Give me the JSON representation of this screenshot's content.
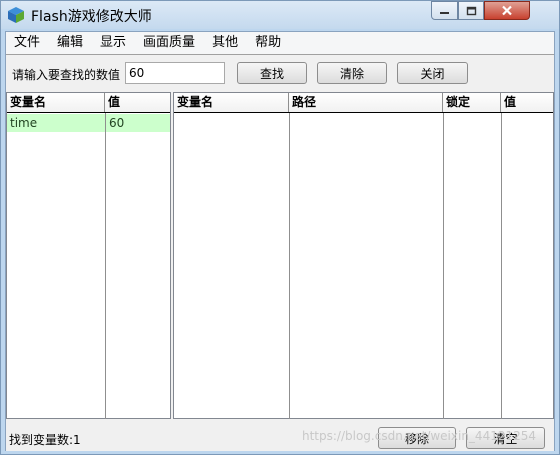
{
  "window": {
    "title": "Flash游戏修改大师"
  },
  "menu": [
    "文件",
    "编辑",
    "显示",
    "画面质量",
    "其他",
    "帮助"
  ],
  "search": {
    "label": "请输入要查找的数值",
    "value": "60",
    "find_label": "查找",
    "clear_label": "清除",
    "close_label": "关闭"
  },
  "left_table": {
    "headers": [
      "变量名",
      "值"
    ],
    "rows": [
      {
        "name": "time",
        "value": "60"
      }
    ]
  },
  "right_table": {
    "headers": [
      "变量名",
      "路径",
      "锁定",
      "值"
    ]
  },
  "status": {
    "found_text": "找到变量数:1",
    "remove_label": "移除",
    "clear_all_label": "清空"
  },
  "watermark": "https://blog.csdn.net/weixin_44121254",
  "colors": {
    "selected_row": "#ccffcc",
    "titlebar": "#c4d9ee",
    "close_button": "#c8412f"
  }
}
